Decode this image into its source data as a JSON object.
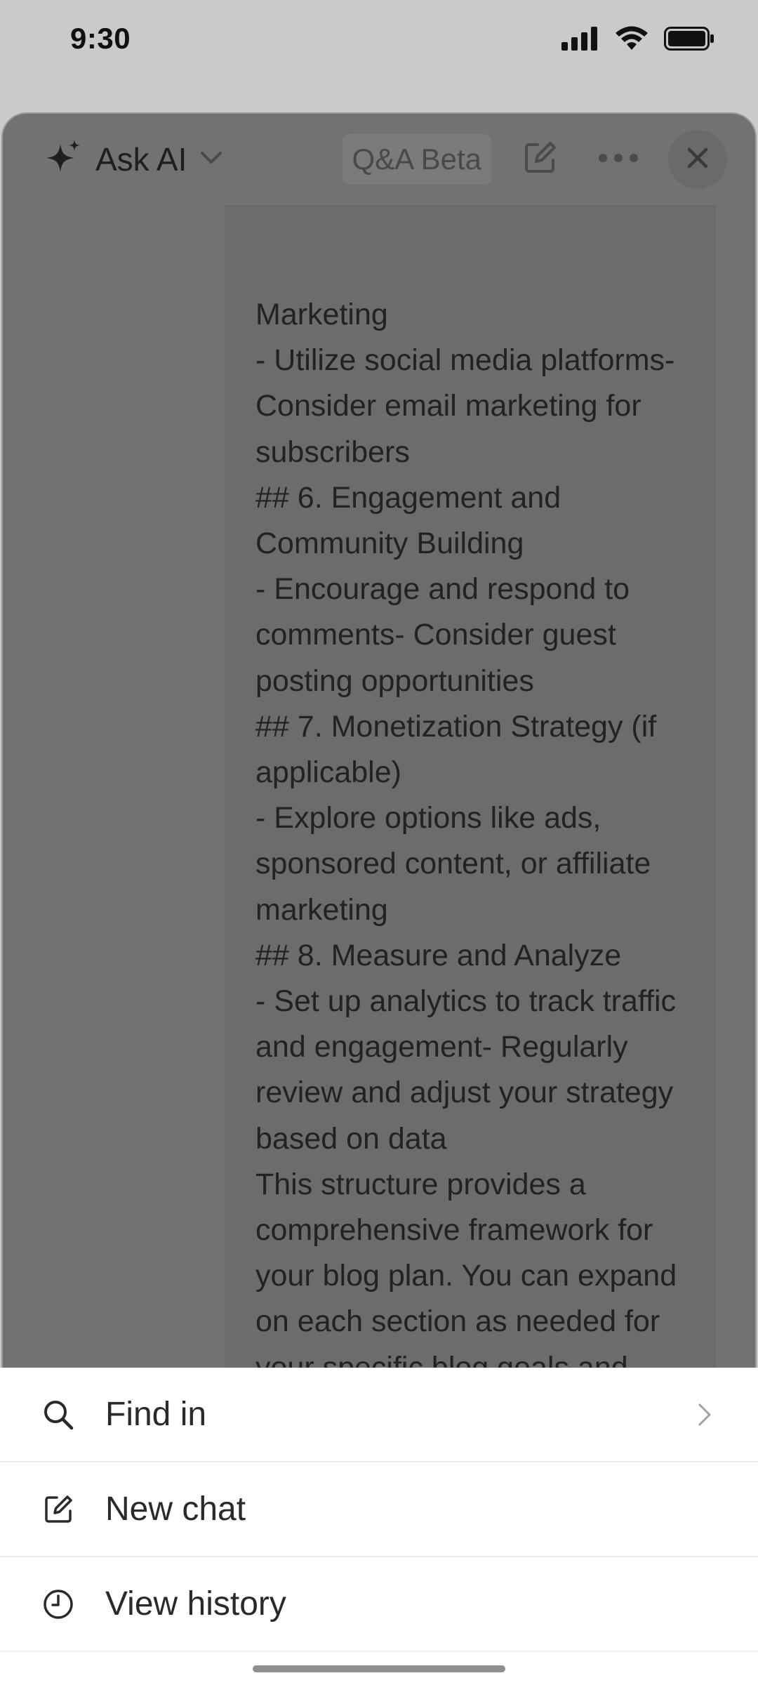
{
  "status_bar": {
    "time": "9:30"
  },
  "header": {
    "title": "Ask AI",
    "mode_pill": "Q&A Beta",
    "icons": [
      "sparkle-icon",
      "chevron-down-icon",
      "compose-icon",
      "more-icon",
      "close-icon"
    ]
  },
  "message": {
    "lines": [
      "Marketing",
      "- Utilize social media platforms- Consider email marketing for subscribers",
      "## 6. Engagement and Community Building",
      "- Encourage and respond to comments- Consider guest posting opportunities",
      "## 7. Monetization Strategy (if applicable)",
      "- Explore options like ads, sponsored content, or affiliate marketing",
      "## 8. Measure and Analyze",
      "- Set up analytics to track traffic and engagement- Regularly review and adjust your strategy based on data",
      "This structure provides a comprehensive framework for your blog plan. You can expand on each section as needed for your specific blog goals and audience."
    ]
  },
  "action_sheet": {
    "items": [
      {
        "label": "Find in",
        "icon": "search-icon",
        "has_chevron": true
      },
      {
        "label": "New chat",
        "icon": "new-chat-icon",
        "has_chevron": false
      },
      {
        "label": "View history",
        "icon": "clock-icon",
        "has_chevron": false
      }
    ]
  },
  "colors": {
    "overlay": "#727272",
    "sheet_bg": "#ffffff",
    "status_bg": "#cacaca"
  }
}
